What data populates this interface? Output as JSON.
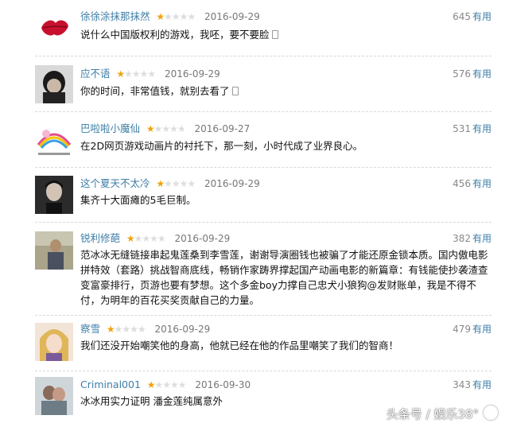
{
  "comments": [
    {
      "user": "徐徐涂抹那抹然",
      "stars": 1,
      "date": "2016-09-29",
      "votes": "645",
      "useful_label": "有用",
      "text": "说什么中国版权利的游戏，我呸，要不要脸",
      "mobile": true
    },
    {
      "user": "应不语",
      "stars": 1,
      "date": "2016-09-29",
      "votes": "576",
      "useful_label": "有用",
      "text": "你的时间，非常值钱，就别去看了",
      "mobile": true
    },
    {
      "user": "巴啦啦小魔仙",
      "stars": 1,
      "date": "2016-09-27",
      "votes": "531",
      "useful_label": "有用",
      "text": "在2D网页游戏动画片的衬托下，那一刻，小时代成了业界良心。",
      "mobile": false
    },
    {
      "user": "这个夏天不太冷",
      "stars": 1,
      "date": "2016-09-29",
      "votes": "456",
      "useful_label": "有用",
      "text": "集齐十大面瘫的5毛巨制。",
      "mobile": false
    },
    {
      "user": "锐利修葩",
      "stars": 1,
      "date": "2016-09-29",
      "votes": "382",
      "useful_label": "有用",
      "text": "范冰冰无缝链接串起鬼莲桑到李雪莲，谢谢导演圈钱也被骗了才能还原金锁本质。国内傲电影拼特效（套路）挑战智商底线，畅销作家踌界撑起国产动画电影的新篇章：有钱能使抄袭渣查变富豪排行，页游也要有梦想。这个多金boy力撑自己忠犬小狼狗@发财账单，我是不得不付，为明年的百花买奖贡献自己的力量。",
      "mobile": false
    },
    {
      "user": "察雪",
      "stars": 1,
      "date": "2016-09-29",
      "votes": "479",
      "useful_label": "有用",
      "text": "我们还没开始嘲笑他的身高，他就已经在他的作品里嘲笑了我们的智商！",
      "mobile": false
    },
    {
      "user": "Criminal001",
      "stars": 1,
      "date": "2016-09-30",
      "votes": "343",
      "useful_label": "有用",
      "text": "冰冰用实力证明 潘金莲纯属意外",
      "mobile": false
    }
  ],
  "max_stars": 5,
  "watermark": "头条号 / 娱乐38°",
  "colors": {
    "link": "#3d7ea6",
    "star_on": "#f0a30a",
    "star_off": "#dddddd"
  }
}
